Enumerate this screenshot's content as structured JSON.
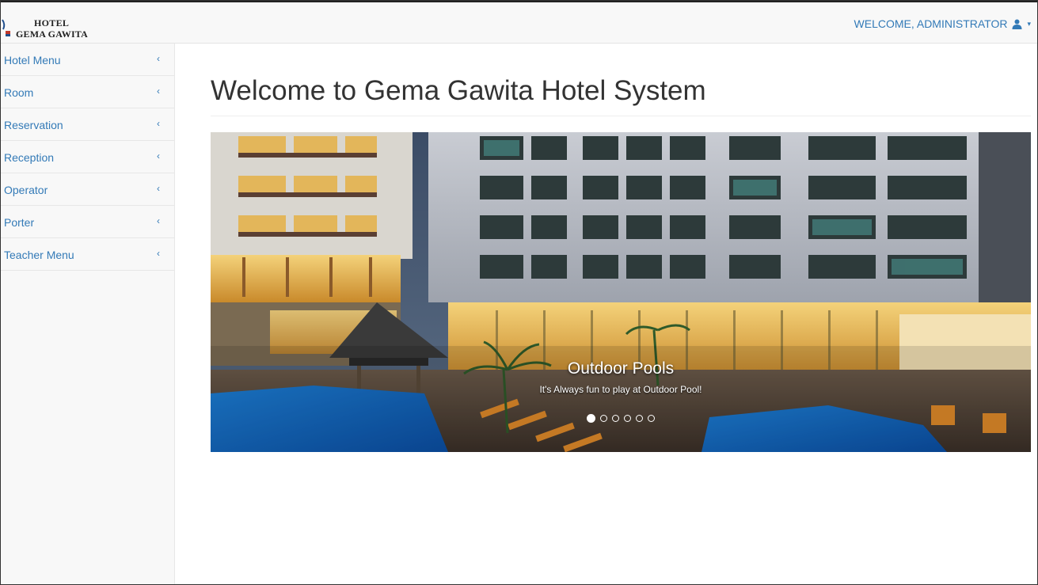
{
  "header": {
    "brand_line1": "HOTEL",
    "brand_line2": "GEMA GAWITA",
    "welcome_text": "WELCOME, ADMINISTRATOR",
    "user_icon": "user-icon",
    "accent_color": "#337ab7"
  },
  "sidebar": {
    "items": [
      {
        "label": "Hotel Menu",
        "icon": "chevron-left-icon"
      },
      {
        "label": "Room",
        "icon": "chevron-left-icon"
      },
      {
        "label": "Reservation",
        "icon": "chevron-left-icon"
      },
      {
        "label": "Reception",
        "icon": "chevron-left-icon"
      },
      {
        "label": "Operator",
        "icon": "chevron-left-icon"
      },
      {
        "label": "Porter",
        "icon": "chevron-left-icon"
      },
      {
        "label": "Teacher Menu",
        "icon": "chevron-left-icon"
      }
    ]
  },
  "main": {
    "title": "Welcome to Gema Gawita Hotel System",
    "carousel": {
      "caption_title": "Outdoor Pools",
      "caption_text": "It's Always fun to play at Outdoor Pool!",
      "slide_count": 6,
      "active_index": 0
    }
  }
}
